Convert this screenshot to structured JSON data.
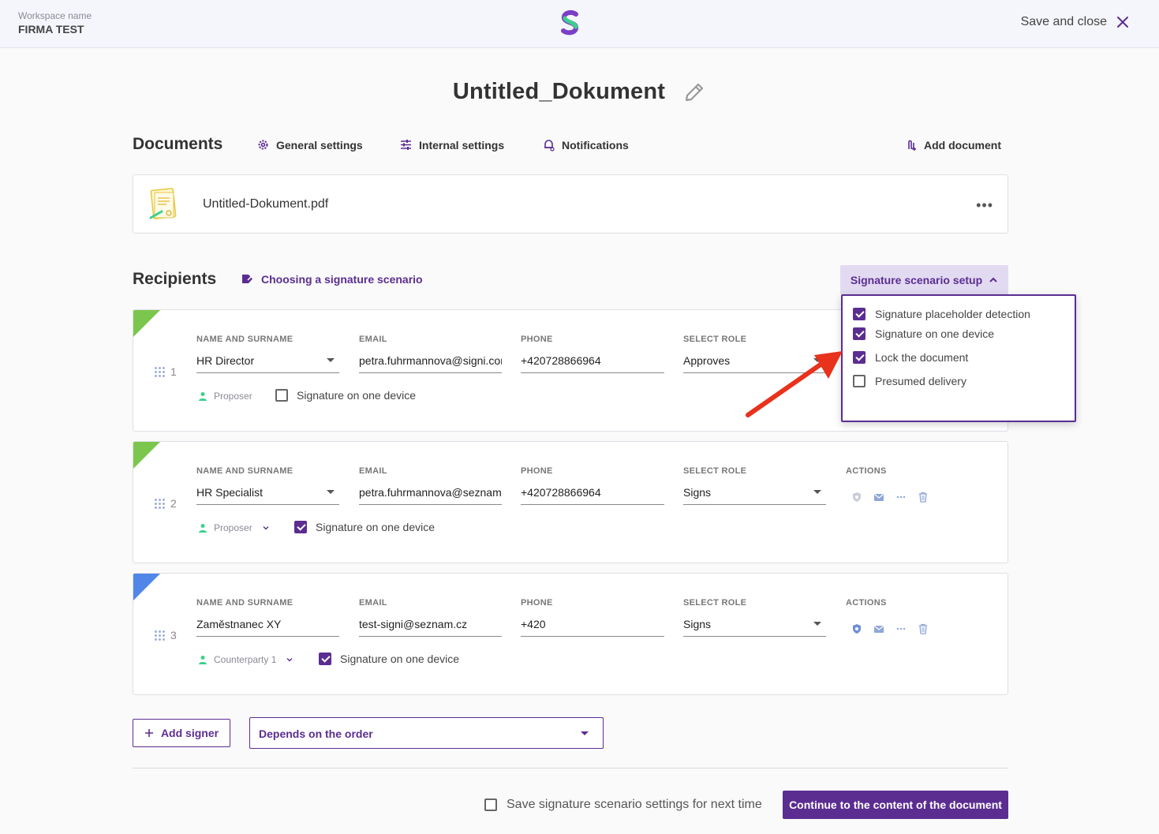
{
  "header": {
    "workspace_label": "Workspace name",
    "workspace_name": "FIRMA TEST",
    "save_close": "Save and close"
  },
  "document": {
    "title": "Untitled_Dokument"
  },
  "documents_section": {
    "title": "Documents",
    "tabs": [
      {
        "label": "General settings",
        "icon": "gear-icon"
      },
      {
        "label": "Internal settings",
        "icon": "sliders-icon"
      },
      {
        "label": "Notifications",
        "icon": "bell-gear-icon"
      }
    ],
    "add_document": "Add document",
    "files": [
      {
        "name": "Untitled-Dokument.pdf",
        "more": "•••"
      }
    ]
  },
  "recipients_section": {
    "title": "Recipients",
    "scenario_link": "Choosing a signature scenario",
    "setup_button": "Signature scenario setup",
    "columns": {
      "name": "NAME AND SURNAME",
      "email": "EMAIL",
      "phone": "PHONE",
      "role": "SELECT ROLE",
      "actions": "ACTIONS"
    },
    "recipients": [
      {
        "index": "1",
        "name": "HR Director",
        "email": "petra.fuhrmannova@signi.cor",
        "phone": "+420728866964",
        "role": "Approves",
        "party": "Proposer",
        "one_device_label": "Signature on one device",
        "one_device_checked": false,
        "corner_color": "#7bc74d"
      },
      {
        "index": "2",
        "name": "HR Specialist",
        "email": "petra.fuhrmannova@seznam.",
        "phone": "+420728866964",
        "role": "Signs",
        "party": "Proposer",
        "one_device_label": "Signature on one device",
        "one_device_checked": true,
        "corner_color": "#7bc74d"
      },
      {
        "index": "3",
        "name": "Zaměstnanec XY",
        "email": "test-signi@seznam.cz",
        "phone": "+420",
        "role": "Signs",
        "party": "Counterparty 1",
        "one_device_label": "Signature on one device",
        "one_device_checked": true,
        "corner_color": "#4f86e8"
      }
    ],
    "setup_options": [
      {
        "label": "Signature placeholder detection",
        "checked": true
      },
      {
        "label": "Signature on one device",
        "checked": true
      },
      {
        "label": "Lock the document",
        "checked": true
      },
      {
        "label": "Presumed delivery",
        "checked": false
      }
    ]
  },
  "footer": {
    "add_signer": "Add signer",
    "order_select": "Depends on the order",
    "save_next": "Save signature scenario settings for next time",
    "continue": "Continue to the content of the document"
  },
  "colors": {
    "accent": "#5b2d91",
    "accent_light": "#e2daf1",
    "arrow": "#e8321c"
  }
}
